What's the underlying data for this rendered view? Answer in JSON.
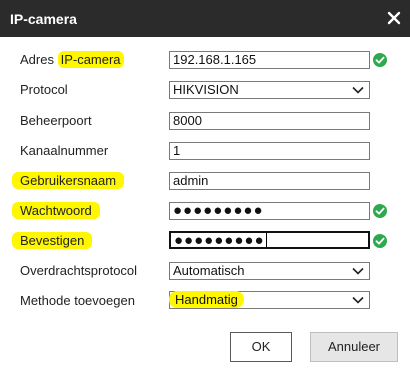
{
  "dialog": {
    "title": "IP-camera"
  },
  "form": {
    "address": {
      "label_prefix": "Adres ",
      "label_highlight": "IP-camera",
      "value": "192.168.1.165"
    },
    "protocol": {
      "label": "Protocol",
      "value": "HIKVISION"
    },
    "port": {
      "label": "Beheerpoort",
      "value": "8000"
    },
    "channel": {
      "label": "Kanaalnummer",
      "value": "1"
    },
    "username": {
      "label": "Gebruikersnaam",
      "value": "admin"
    },
    "password": {
      "label": "Wachtwoord",
      "value": "●●●●●●●●●"
    },
    "confirm": {
      "label": "Bevestigen",
      "value": "●●●●●●●●●"
    },
    "transport": {
      "label": "Overdrachtsprotocol",
      "value": "Automatisch"
    },
    "add_method": {
      "label": "Methode toevoegen",
      "value": "Handmatig"
    }
  },
  "buttons": {
    "ok": "OK",
    "cancel": "Annuleer"
  },
  "colors": {
    "titlebar": "#2b2b2b",
    "highlight": "#fff700",
    "valid": "#2fa94e"
  },
  "icons": {
    "close": "close-icon",
    "valid": "check-circle-icon",
    "dropdown": "chevron-down-icon"
  }
}
